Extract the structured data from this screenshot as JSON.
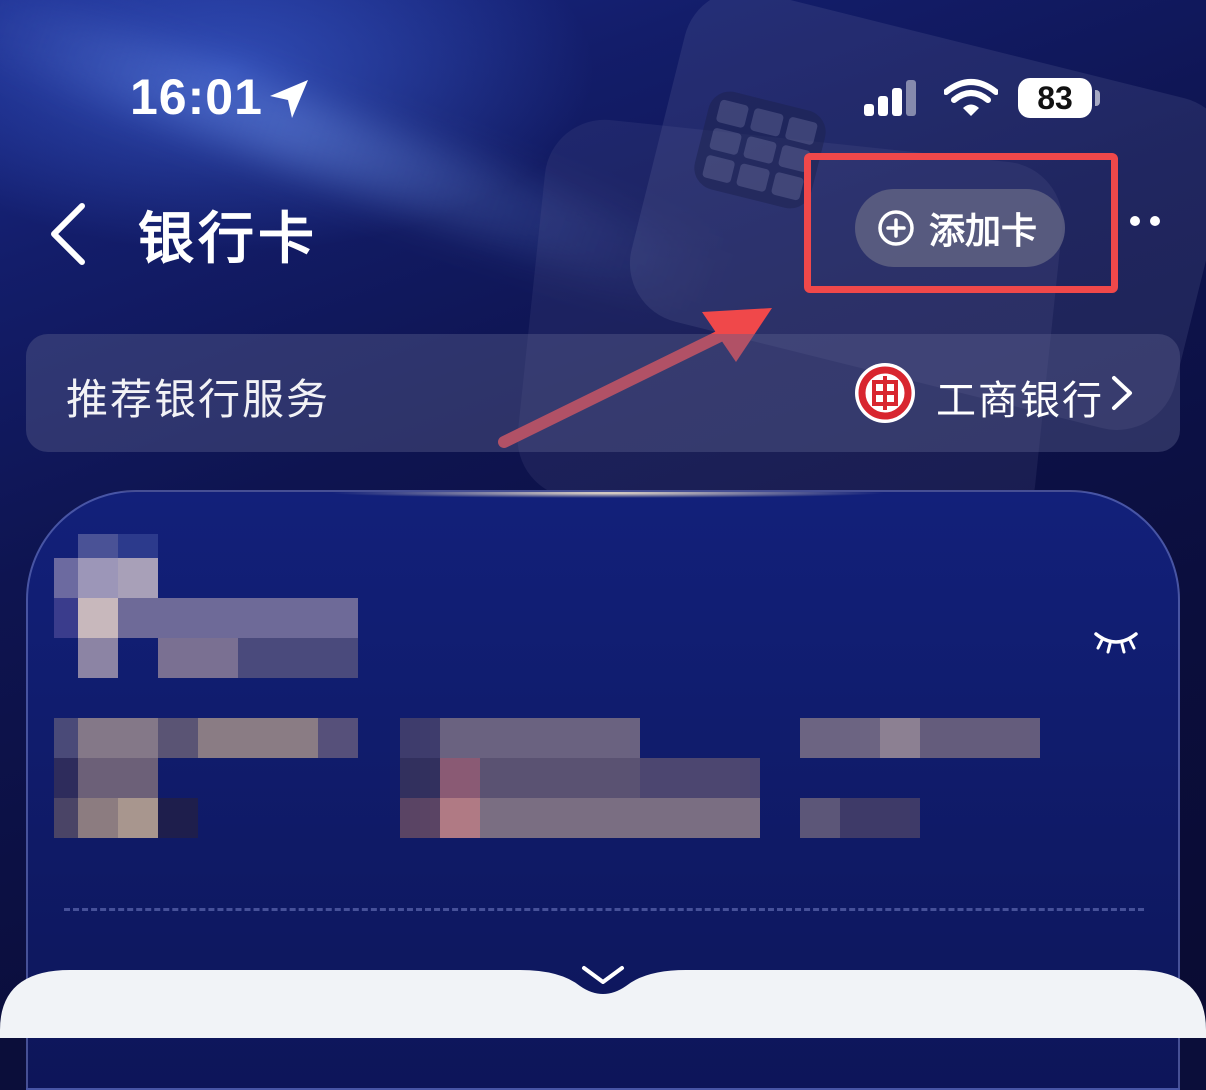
{
  "status_bar": {
    "time": "16:01",
    "battery": "83",
    "icons": [
      "location-arrow-icon",
      "signal-icon",
      "wifi-icon",
      "battery-icon"
    ]
  },
  "nav": {
    "title": "银行卡",
    "add_card_label": "添加卡",
    "icons": [
      "back-chevron-icon",
      "plus-circle-icon",
      "more-icon"
    ]
  },
  "recommend": {
    "label": "推荐银行服务",
    "bank_name": "工商银行",
    "icons": [
      "icbc-logo",
      "chevron-right-icon"
    ]
  },
  "card": {
    "icons": [
      "eye-closed-icon",
      "chevron-down-icon"
    ]
  },
  "colors": {
    "highlight_box": "#f0484a",
    "background": "#0b0e3a",
    "bank_logo_red": "#d8262f",
    "sheet": "#f1f3f7"
  }
}
